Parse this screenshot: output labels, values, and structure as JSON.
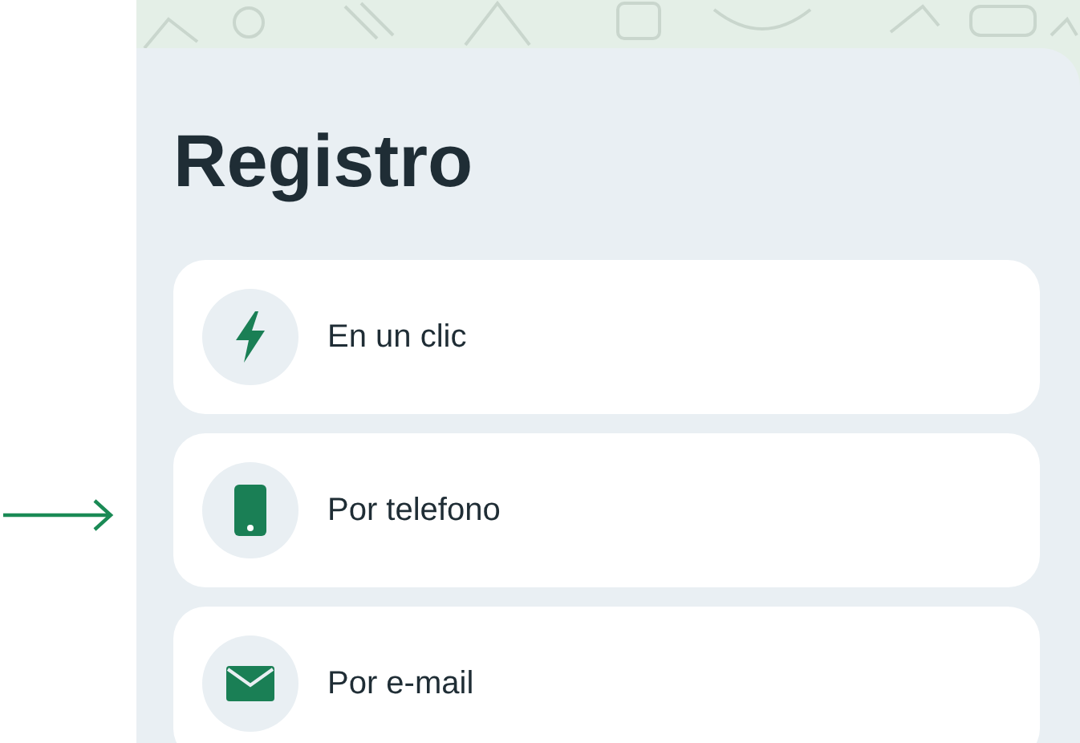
{
  "title": "Registro",
  "options": [
    {
      "kind": "bolt",
      "label": "En un clic"
    },
    {
      "kind": "phone",
      "label": "Por telefono"
    },
    {
      "kind": "mail",
      "label": "Por e-mail"
    }
  ]
}
